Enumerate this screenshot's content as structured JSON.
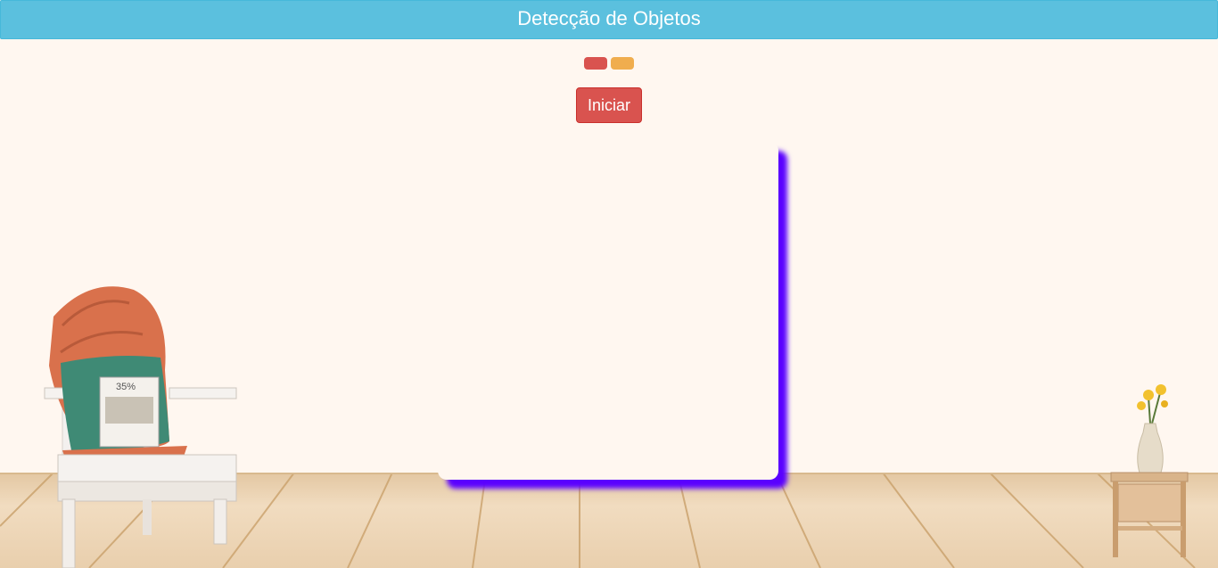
{
  "header": {
    "title": "Detecção de Objetos"
  },
  "status": {
    "indicators": [
      {
        "name": "red-indicator",
        "color": "#d9534f"
      },
      {
        "name": "orange-indicator",
        "color": "#f0ad4e"
      }
    ]
  },
  "controls": {
    "start_label": "Iniciar"
  },
  "decor": {
    "pillow_tag": "35%"
  },
  "colors": {
    "header_bg": "#5bc0de",
    "start_button": "#d9534f",
    "panel_shadow": "#5a00ff",
    "background": "#fff7f0"
  }
}
